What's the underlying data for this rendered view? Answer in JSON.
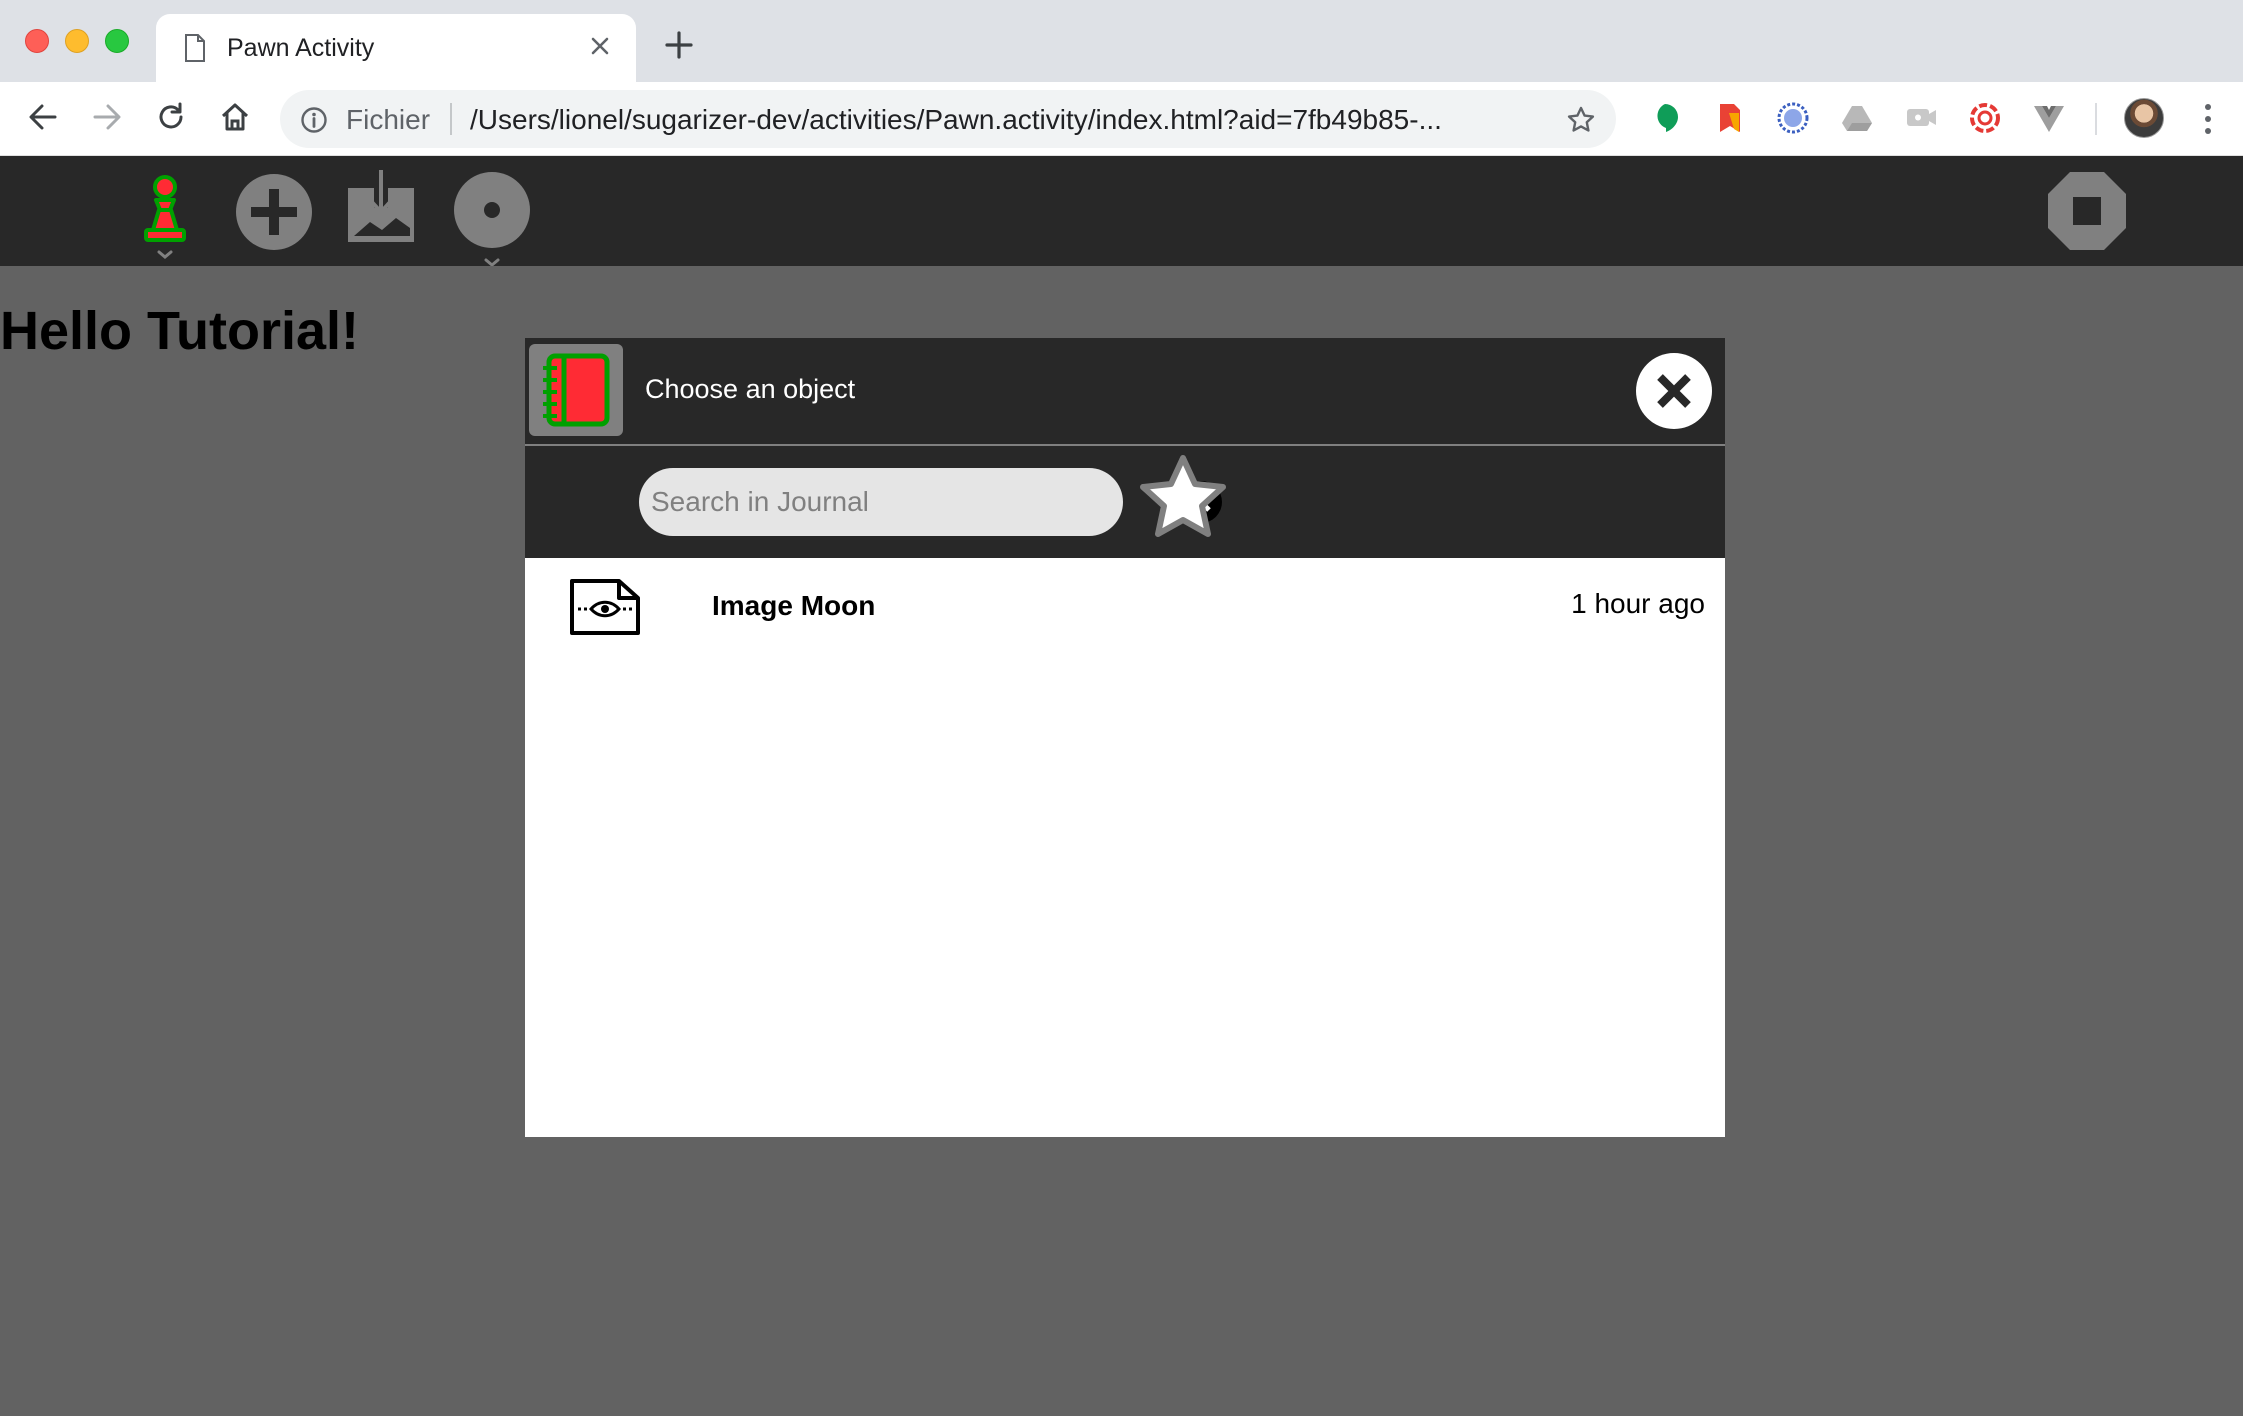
{
  "browser": {
    "tab_title": "Pawn Activity",
    "url_scheme_label": "Fichier",
    "url": "/Users/lionel/sugarizer-dev/activities/Pawn.activity/index.html?aid=7fb49b85-..."
  },
  "page": {
    "heading": "Hello Tutorial!"
  },
  "dialog": {
    "title": "Choose an object",
    "search_placeholder": "Search in Journal",
    "search_value": "",
    "entries": [
      {
        "title": "Image Moon",
        "time": "1 hour ago",
        "icon": "image-viewer-icon"
      }
    ]
  },
  "colors": {
    "sugar_toolbar": "#282828",
    "page_background": "#626262",
    "xo_stroke": "#00a000",
    "xo_fill": "#ff2b34"
  }
}
